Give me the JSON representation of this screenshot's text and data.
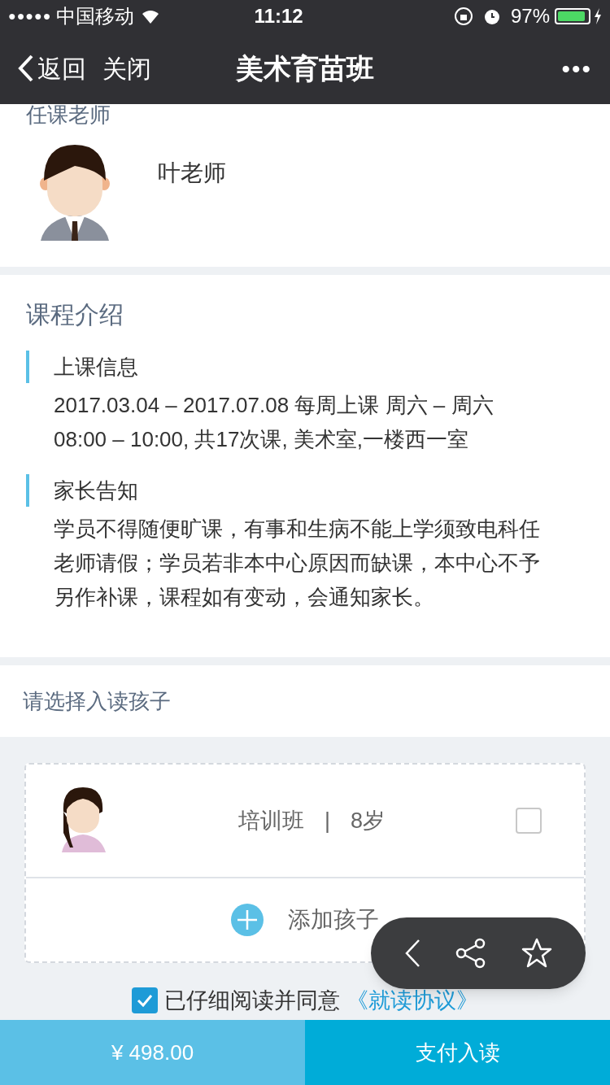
{
  "status_bar": {
    "signal": "●●●●●",
    "carrier": "中国移动",
    "time": "11:12",
    "battery": "97%"
  },
  "nav": {
    "back": "返回",
    "close": "关闭",
    "title": "美术育苗班",
    "more": "•••"
  },
  "teacher": {
    "heading": "任课老师",
    "name": "叶老师"
  },
  "course": {
    "heading": "课程介绍",
    "sections": [
      {
        "title": "上课信息",
        "body": "2017.03.04 – 2017.07.08 每周上课 周六 – 周六 08:00 – 10:00, 共17次课, 美术室,一楼西一室"
      },
      {
        "title": "家长告知",
        "body": "学员不得随便旷课，有事和生病不能上学须致电科任老师请假；学员若非本中心原因而缺课，本中心不予另作补课，课程如有变动，会通知家长。"
      }
    ]
  },
  "children": {
    "heading": "请选择入读孩子",
    "items": [
      {
        "class": "培训班",
        "separator": "|",
        "age": "8岁",
        "checked": false
      }
    ],
    "add": "添加孩子"
  },
  "agreement": {
    "checked": true,
    "text": "已仔细阅读并同意",
    "link": "《就读协议》"
  },
  "footer": {
    "price": "¥ 498.00",
    "pay": "支付入读"
  }
}
